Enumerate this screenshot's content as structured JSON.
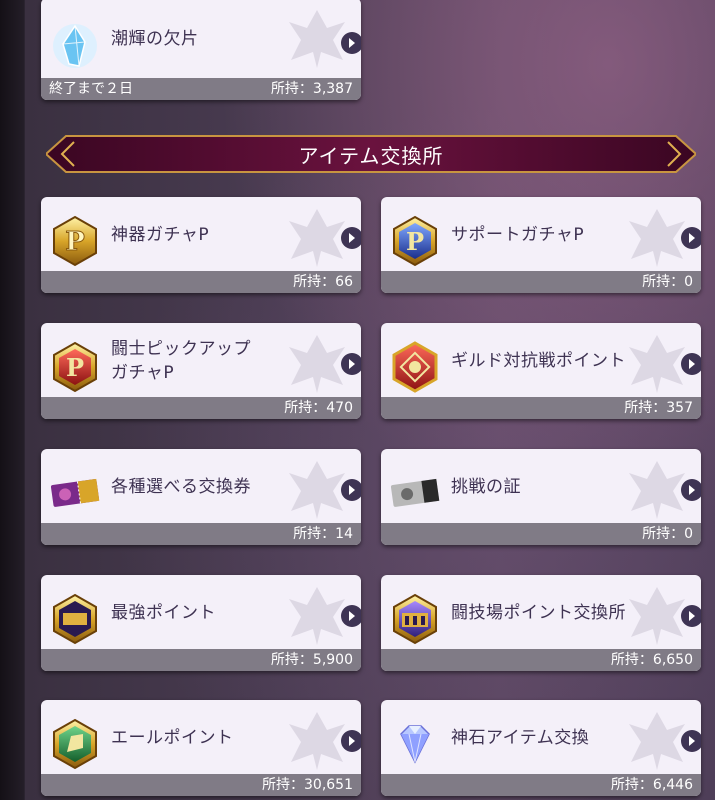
{
  "top_card": {
    "name": "潮輝の欠片",
    "icon": "crystal-shard-icon",
    "ends": "終了まで２日",
    "held": "所持：3,387"
  },
  "section": {
    "title": "アイテム交換所"
  },
  "items": [
    {
      "name": "神器ガチャP",
      "icon": "gold-p-medal-icon",
      "held": "所持：66"
    },
    {
      "name": "サポートガチャP",
      "icon": "blue-p-medal-icon",
      "held": "所持：0"
    },
    {
      "name": "闘士ピックアップ\nガチャP",
      "icon": "red-p-medal-icon",
      "held": "所持：470"
    },
    {
      "name": "ギルド対抗戦ポイント",
      "icon": "guild-crest-icon",
      "held": "所持：357"
    },
    {
      "name": "各種選べる交換券",
      "icon": "ticket-icon",
      "held": "所持：14"
    },
    {
      "name": "挑戦の証",
      "icon": "silver-ticket-icon",
      "held": "所持：0"
    },
    {
      "name": "最強ポイント",
      "icon": "strongest-medal-icon",
      "held": "所持：5,900"
    },
    {
      "name": "闘技場ポイント交換所",
      "icon": "colosseum-medal-icon",
      "held": "所持：6,650"
    },
    {
      "name": "エールポイント",
      "icon": "cheer-medal-icon",
      "held": "所持：30,651"
    },
    {
      "name": "神石アイテム交換",
      "icon": "diamond-icon",
      "held": "所持：6,446"
    }
  ],
  "colors": {
    "card_bg": "#f4f0f9",
    "footer_bg": "#807b86",
    "text": "#3e3252",
    "banner": "#5a0f36"
  }
}
